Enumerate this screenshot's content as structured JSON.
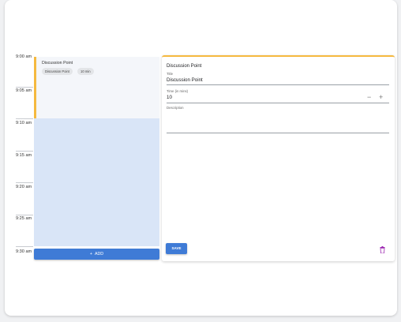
{
  "timeline": {
    "times": [
      "9:00 am",
      "9:05 am",
      "9:10 am",
      "9:15 am",
      "9:20 am",
      "9:25 am",
      "9:30 am"
    ],
    "event": {
      "title": "Discussion Point",
      "chips": [
        "Discussion Point",
        "10 min"
      ],
      "accent_color": "#f5b93f"
    },
    "add_button": {
      "label": "ADD",
      "icon": "plus-icon"
    }
  },
  "panel": {
    "heading": "Discussion Point",
    "title_field": {
      "label": "Title",
      "value": "Discussion Point"
    },
    "time_field": {
      "label": "Time (in mins)",
      "value": "10"
    },
    "description_field": {
      "label": "Description",
      "value": ""
    },
    "save_label": "SAVE",
    "delete_icon": "trash-icon",
    "delete_color": "#9c27b0"
  },
  "colors": {
    "primary": "#3f7bd6",
    "slot": "#d9e5f7",
    "accent": "#f5b93f"
  }
}
